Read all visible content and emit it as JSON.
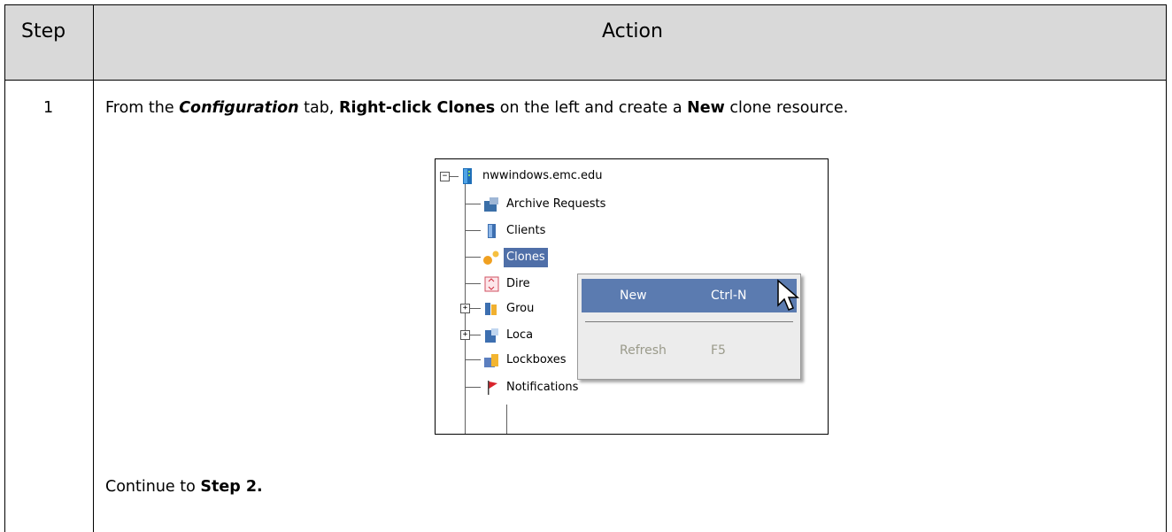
{
  "table": {
    "header": {
      "step": "Step",
      "action": "Action"
    },
    "rows": [
      {
        "step": "1",
        "instruction": {
          "p1": "From the ",
          "tab": "Configuration",
          "p2": " tab, ",
          "rc": "Right-click Clones",
          "p3": " on the left and create a ",
          "new": "New",
          "p4": " clone resource."
        },
        "continue": {
          "p1": "Continue to ",
          "step_ref": "Step 2."
        }
      }
    ]
  },
  "screenshot": {
    "tree": {
      "root": "nwwindows.emc.edu",
      "items": [
        {
          "label": "Archive Requests",
          "icon": "archive-requests-icon"
        },
        {
          "label": "Clients",
          "icon": "clients-icon"
        },
        {
          "label": "Clones",
          "icon": "clones-icon"
        },
        {
          "label": "Dire",
          "icon": "directives-icon"
        },
        {
          "label": "Grou",
          "icon": "groups-icon"
        },
        {
          "label": "Loca",
          "icon": "local-icon"
        },
        {
          "label": "Lockboxes",
          "icon": "lockboxes-icon"
        },
        {
          "label": "Notifications",
          "icon": "notifications-icon"
        }
      ]
    },
    "context_menu": {
      "items": [
        {
          "label": "New",
          "shortcut": "Ctrl-N"
        },
        {
          "label": "Refresh",
          "shortcut": "F5"
        }
      ]
    }
  }
}
